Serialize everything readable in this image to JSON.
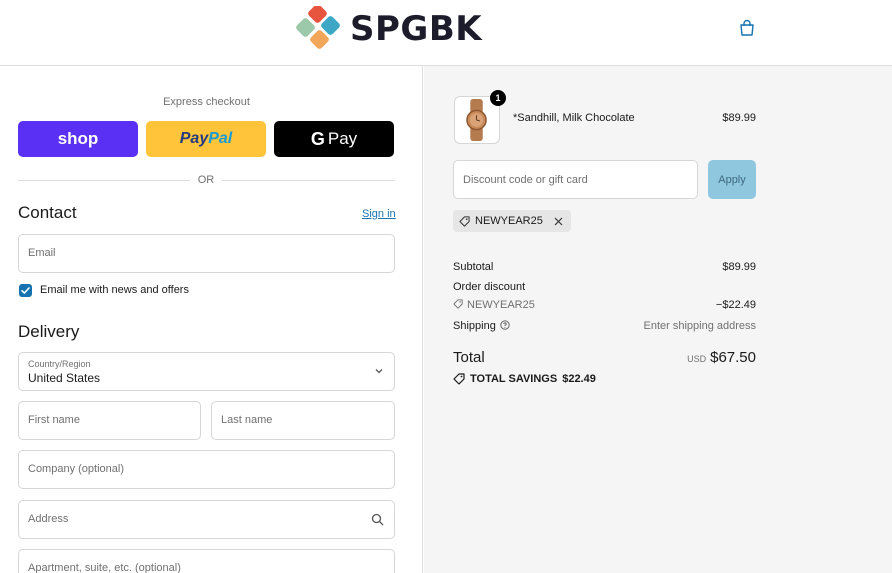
{
  "header": {
    "brand": "SPGBK",
    "logo_colors": [
      "#e8553f",
      "#3ea7c6",
      "#9bc9a9",
      "#f2a65a"
    ],
    "cart_icon": "shopping-bag-icon",
    "accent": "#1773b0"
  },
  "express": {
    "label": "Express checkout",
    "shop_label": "shop",
    "paypal_part1": "Pay",
    "paypal_part2": "Pal",
    "gpay_g": "G",
    "gpay_label": "Pay",
    "or_label": "OR"
  },
  "contact": {
    "title": "Contact",
    "signin_label": "Sign in",
    "email_placeholder": "Email",
    "newsletter_label": "Email me with news and offers",
    "newsletter_checked": true
  },
  "delivery": {
    "title": "Delivery",
    "country_label": "Country/Region",
    "country_value": "United States",
    "first_name_placeholder": "First name",
    "last_name_placeholder": "Last name",
    "company_placeholder": "Company (optional)",
    "address_placeholder": "Address",
    "apartment_placeholder": "Apartment, suite, etc. (optional)"
  },
  "summary": {
    "product": {
      "name": "*Sandhill, Milk Chocolate",
      "price": "$89.99",
      "quantity": "1"
    },
    "discount_placeholder": "Discount code or gift card",
    "apply_label": "Apply",
    "applied_code": "NEWYEAR25",
    "subtotal_label": "Subtotal",
    "subtotal_value": "$89.99",
    "order_discount_label": "Order discount",
    "discount_code": "NEWYEAR25",
    "discount_value": "−$22.49",
    "shipping_label": "Shipping",
    "shipping_value": "Enter shipping address",
    "total_label": "Total",
    "currency": "USD",
    "total_value": "$67.50",
    "savings_label": "TOTAL SAVINGS",
    "savings_value": "$22.49"
  }
}
